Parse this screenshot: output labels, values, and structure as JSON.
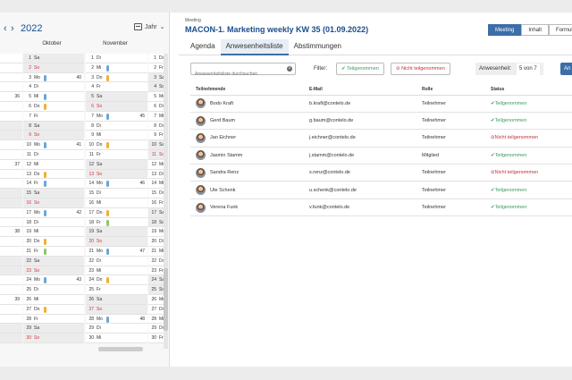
{
  "calendar": {
    "year": "2022",
    "view_label": "Jahr",
    "months": [
      {
        "name": "",
        "days": [
          {
            "n": "",
            "d": "",
            "w": "",
            "wk": false,
            "sun": false,
            "bar": ""
          }
        ]
      },
      {
        "name": "Oktober",
        "days": [
          {
            "n": "1",
            "d": "Sa",
            "wk": true
          },
          {
            "n": "2",
            "d": "So",
            "wk": true,
            "sun": true
          },
          {
            "n": "3",
            "d": "Mo",
            "w": "40",
            "bar": "blue"
          },
          {
            "n": "4",
            "d": "Di"
          },
          {
            "n": "5",
            "d": "Mi",
            "bar": "blue"
          },
          {
            "n": "6",
            "d": "Do",
            "bar": "orange"
          },
          {
            "n": "7",
            "d": "Fr"
          },
          {
            "n": "8",
            "d": "Sa",
            "wk": true
          },
          {
            "n": "9",
            "d": "So",
            "wk": true,
            "sun": true
          },
          {
            "n": "10",
            "d": "Mo",
            "w": "41",
            "bar": "blue"
          },
          {
            "n": "11",
            "d": "Di"
          },
          {
            "n": "12",
            "d": "Mi"
          },
          {
            "n": "13",
            "d": "Do",
            "bar": "orange"
          },
          {
            "n": "14",
            "d": "Fr",
            "bar": "blue"
          },
          {
            "n": "15",
            "d": "Sa",
            "wk": true
          },
          {
            "n": "16",
            "d": "So",
            "wk": true,
            "sun": true
          },
          {
            "n": "17",
            "d": "Mo",
            "w": "42",
            "bar": "blue"
          },
          {
            "n": "18",
            "d": "Di"
          },
          {
            "n": "19",
            "d": "Mi"
          },
          {
            "n": "20",
            "d": "Do",
            "bar": "orange"
          },
          {
            "n": "21",
            "d": "Fr",
            "bar": "green"
          },
          {
            "n": "22",
            "d": "Sa",
            "wk": true
          },
          {
            "n": "23",
            "d": "So",
            "wk": true,
            "sun": true
          },
          {
            "n": "24",
            "d": "Mo",
            "w": "43",
            "bar": "blue"
          },
          {
            "n": "25",
            "d": "Di"
          },
          {
            "n": "26",
            "d": "Mi"
          },
          {
            "n": "27",
            "d": "Do",
            "bar": "orange"
          },
          {
            "n": "28",
            "d": "Fr"
          },
          {
            "n": "29",
            "d": "Sa",
            "wk": true
          },
          {
            "n": "30",
            "d": "So",
            "wk": true,
            "sun": true
          }
        ]
      },
      {
        "name": "November",
        "days": [
          {
            "n": "1",
            "d": "Di"
          },
          {
            "n": "2",
            "d": "Mi",
            "bar": "blue"
          },
          {
            "n": "3",
            "d": "Do",
            "bar": "orange"
          },
          {
            "n": "4",
            "d": "Fr"
          },
          {
            "n": "5",
            "d": "Sa",
            "wk": true
          },
          {
            "n": "6",
            "d": "So",
            "wk": true,
            "sun": true
          },
          {
            "n": "7",
            "d": "Mo",
            "w": "45",
            "bar": "blue"
          },
          {
            "n": "8",
            "d": "Di"
          },
          {
            "n": "9",
            "d": "Mi"
          },
          {
            "n": "10",
            "d": "Do",
            "bar": "orange"
          },
          {
            "n": "11",
            "d": "Fr"
          },
          {
            "n": "12",
            "d": "Sa",
            "wk": true
          },
          {
            "n": "13",
            "d": "So",
            "wk": true,
            "sun": true
          },
          {
            "n": "14",
            "d": "Mo",
            "w": "46",
            "bar": "blue"
          },
          {
            "n": "15",
            "d": "Di"
          },
          {
            "n": "16",
            "d": "Mi"
          },
          {
            "n": "17",
            "d": "Do",
            "bar": "orange"
          },
          {
            "n": "18",
            "d": "Fr",
            "bar": "green"
          },
          {
            "n": "19",
            "d": "Sa",
            "wk": true
          },
          {
            "n": "20",
            "d": "So",
            "wk": true,
            "sun": true
          },
          {
            "n": "21",
            "d": "Mo",
            "w": "47",
            "bar": "blue"
          },
          {
            "n": "22",
            "d": "Di"
          },
          {
            "n": "23",
            "d": "Mi"
          },
          {
            "n": "24",
            "d": "Do",
            "bar": "orange"
          },
          {
            "n": "25",
            "d": "Fr"
          },
          {
            "n": "26",
            "d": "Sa",
            "wk": true
          },
          {
            "n": "27",
            "d": "So",
            "wk": true,
            "sun": true
          },
          {
            "n": "28",
            "d": "Mo",
            "w": "48",
            "bar": "blue"
          },
          {
            "n": "29",
            "d": "Di"
          },
          {
            "n": "30",
            "d": "Mi"
          }
        ]
      },
      {
        "name": "",
        "days": [
          {
            "n": "1",
            "d": "Do"
          },
          {
            "n": "2",
            "d": "Fr"
          },
          {
            "n": "3",
            "d": "Sa",
            "wk": true
          },
          {
            "n": "4",
            "d": "So",
            "wk": true
          },
          {
            "n": "5",
            "d": "Mo"
          },
          {
            "n": "6",
            "d": "Di"
          },
          {
            "n": "7",
            "d": "Mi"
          },
          {
            "n": "8",
            "d": "Do"
          },
          {
            "n": "9",
            "d": "Fr"
          },
          {
            "n": "10",
            "d": "Sa",
            "wk": true
          },
          {
            "n": "11",
            "d": "So",
            "wk": true,
            "sun": true
          },
          {
            "n": "12",
            "d": "Mo"
          },
          {
            "n": "13",
            "d": "Di"
          },
          {
            "n": "14",
            "d": "Mi"
          },
          {
            "n": "15",
            "d": "Do"
          },
          {
            "n": "16",
            "d": "Fr"
          },
          {
            "n": "17",
            "d": "Sa",
            "wk": true
          },
          {
            "n": "18",
            "d": "So",
            "wk": true
          },
          {
            "n": "19",
            "d": "Mo"
          },
          {
            "n": "20",
            "d": "Di"
          },
          {
            "n": "21",
            "d": "Mi"
          },
          {
            "n": "22",
            "d": "Do"
          },
          {
            "n": "23",
            "d": "Fr"
          },
          {
            "n": "24",
            "d": "Sa",
            "wk": true
          },
          {
            "n": "25",
            "d": "So",
            "wk": true
          },
          {
            "n": "26",
            "d": "Mo"
          },
          {
            "n": "27",
            "d": "Di"
          },
          {
            "n": "28",
            "d": "Mi"
          },
          {
            "n": "29",
            "d": "Do"
          },
          {
            "n": "30",
            "d": "Fr"
          }
        ]
      }
    ],
    "left_col": [
      {
        "w": "",
        "wk": false
      },
      {
        "w": "",
        "wk": false
      },
      {
        "w": "",
        "wk": false
      },
      {
        "w": "",
        "wk": false
      },
      {
        "w": "36",
        "wk": false
      },
      {
        "w": "",
        "wk": false
      },
      {
        "w": "",
        "wk": false
      },
      {
        "w": "",
        "wk": true
      },
      {
        "w": "",
        "wk": true
      },
      {
        "w": "",
        "wk": false
      },
      {
        "w": "",
        "wk": false
      },
      {
        "w": "37",
        "wk": false
      },
      {
        "w": "",
        "wk": false
      },
      {
        "w": "",
        "wk": false
      },
      {
        "w": "",
        "wk": true
      },
      {
        "w": "",
        "wk": true
      },
      {
        "w": "",
        "wk": false
      },
      {
        "w": "",
        "wk": false
      },
      {
        "w": "38",
        "wk": false
      },
      {
        "w": "",
        "wk": false
      },
      {
        "w": "",
        "wk": false
      },
      {
        "w": "",
        "wk": true
      },
      {
        "w": "",
        "wk": true
      },
      {
        "w": "",
        "wk": false
      },
      {
        "w": "",
        "wk": false
      },
      {
        "w": "39",
        "wk": false
      },
      {
        "w": "",
        "wk": false
      },
      {
        "w": "",
        "wk": false
      },
      {
        "w": "",
        "wk": true
      },
      {
        "w": "",
        "wk": true
      }
    ]
  },
  "meeting": {
    "label": "Meeting",
    "title": "MACON-1. Marketing weekly KW 35 (01.09.2022)",
    "view_tabs": [
      "Meeting",
      "Inhalt",
      "Formular"
    ],
    "tabs": [
      "Agenda",
      "Anwesenheitsliste",
      "Abstimmungen"
    ],
    "search_placeholder": "Anwesenheitsliste durchsuchen",
    "filter_label": "Filter:",
    "filter_ok": "Teilgenommen",
    "filter_no": "Nicht teilgenommen",
    "presence_label": "Anwesenheit:",
    "presence_value": "5 von 7",
    "action_label": "An",
    "columns": [
      "Teilnehmende",
      "E-Mail",
      "Rolle",
      "Status"
    ],
    "rows": [
      {
        "name": "Bodo Kraft",
        "email": "b.kraft@contelo.de",
        "role": "Teilnehmer",
        "status": "Teilgenommen",
        "ok": true
      },
      {
        "name": "Gerd Baum",
        "email": "g.baum@contelo.de",
        "role": "Teilnehmer",
        "status": "Teilgenommen",
        "ok": true
      },
      {
        "name": "Jan Eichner",
        "email": "j.eichner@contelo.de",
        "role": "Teilnehmer",
        "status": "Nicht teilgenommen",
        "ok": false
      },
      {
        "name": "Jasmin Stamm",
        "email": "j.stamm@contelo.de",
        "role": "Mitglied",
        "status": "Teilgenommen",
        "ok": true
      },
      {
        "name": "Sandra Renz",
        "email": "s.renz@contelo.de",
        "role": "Teilnehmer",
        "status": "Nicht teilgenommen",
        "ok": false
      },
      {
        "name": "Ute Schenk",
        "email": "u.schenk@contelo.de",
        "role": "Teilnehmer",
        "status": "Teilgenommen",
        "ok": true
      },
      {
        "name": "Verena Funk",
        "email": "v.funk@contelo.de",
        "role": "Teilnehmer",
        "status": "Teilgenommen",
        "ok": true
      }
    ]
  }
}
